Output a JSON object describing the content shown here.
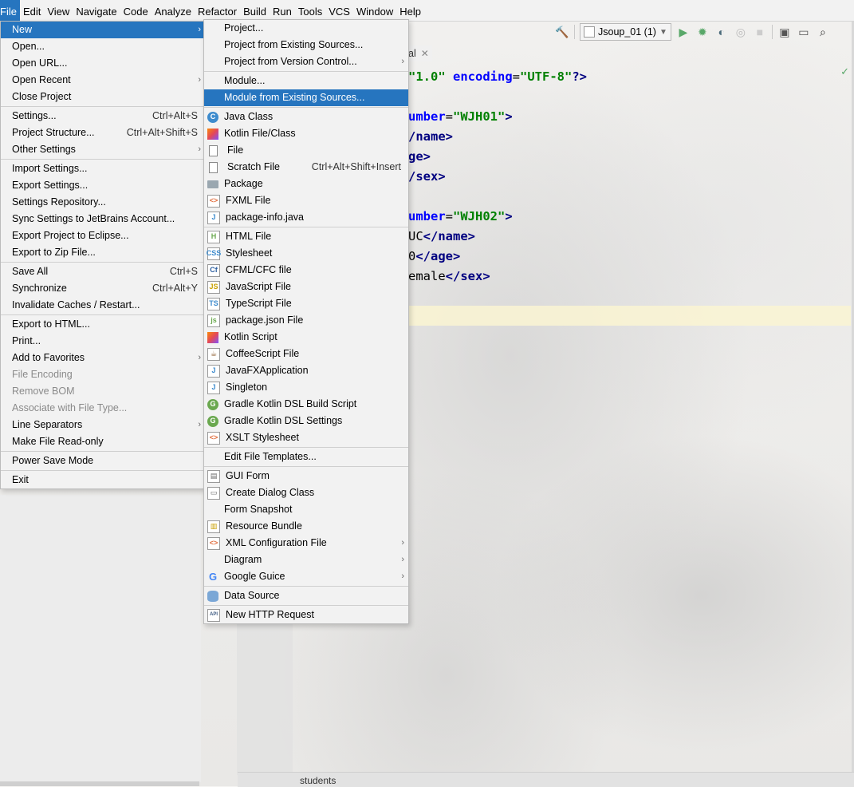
{
  "menubar": {
    "items": [
      "File",
      "Edit",
      "View",
      "Navigate",
      "Code",
      "Analyze",
      "Refactor",
      "Build",
      "Run",
      "Tools",
      "VCS",
      "Window",
      "Help"
    ]
  },
  "toolbar": {
    "run_config": "Jsoup_01 (1)",
    "icons": [
      "hammer-icon",
      "run-icon",
      "debug-icon",
      "coverage-icon",
      "profile-icon",
      "stop-icon",
      "project-structure-icon",
      "layout-icon",
      "search-icon"
    ],
    "colors": {
      "run": "#59a869",
      "hammer": "#59a869"
    }
  },
  "editor": {
    "tab_label": "al",
    "status_tab": "students",
    "code_lines": [
      "\"1.0\" encoding=\"UTF-8\"?>",
      "",
      "umber=\"WJH01\">",
      "/name>",
      "ge>",
      "/sex>",
      "",
      "umber=\"WJH02\">",
      "UC</name>",
      "0</age>",
      "emale</sex>"
    ]
  },
  "file_menu": {
    "items": [
      {
        "label": "New",
        "selected": true,
        "submenu": true
      },
      {
        "label": "Open..."
      },
      {
        "label": "Open URL..."
      },
      {
        "label": "Open Recent",
        "submenu": true
      },
      {
        "label": "Close Project"
      },
      {
        "sep": true
      },
      {
        "label": "Settings...",
        "shortcut": "Ctrl+Alt+S"
      },
      {
        "label": "Project Structure...",
        "shortcut": "Ctrl+Alt+Shift+S"
      },
      {
        "label": "Other Settings",
        "submenu": true
      },
      {
        "sep": true
      },
      {
        "label": "Import Settings..."
      },
      {
        "label": "Export Settings..."
      },
      {
        "label": "Settings Repository..."
      },
      {
        "label": "Sync Settings to JetBrains Account..."
      },
      {
        "label": "Export Project to Eclipse..."
      },
      {
        "label": "Export to Zip File..."
      },
      {
        "sep": true
      },
      {
        "label": "Save All",
        "shortcut": "Ctrl+S"
      },
      {
        "label": "Synchronize",
        "shortcut": "Ctrl+Alt+Y"
      },
      {
        "label": "Invalidate Caches / Restart..."
      },
      {
        "sep": true
      },
      {
        "label": "Export to HTML..."
      },
      {
        "label": "Print..."
      },
      {
        "label": "Add to Favorites",
        "submenu": true
      },
      {
        "label": "File Encoding",
        "disabled": true
      },
      {
        "label": "Remove BOM",
        "disabled": true
      },
      {
        "label": "Associate with File Type...",
        "disabled": true
      },
      {
        "label": "Line Separators",
        "submenu": true
      },
      {
        "label": "Make File Read-only"
      },
      {
        "sep": true
      },
      {
        "label": "Power Save Mode"
      },
      {
        "sep": true
      },
      {
        "label": "Exit"
      }
    ]
  },
  "new_menu": {
    "items": [
      {
        "label": "Project...",
        "icon": ""
      },
      {
        "label": "Project from Existing Sources...",
        "icon": ""
      },
      {
        "label": "Project from Version Control...",
        "icon": "",
        "submenu": true
      },
      {
        "sep": true
      },
      {
        "label": "Module...",
        "icon": ""
      },
      {
        "label": "Module from Existing Sources...",
        "icon": "",
        "selected": true
      },
      {
        "sep": true
      },
      {
        "label": "Java Class",
        "icon": "java-class-icon"
      },
      {
        "label": "Kotlin File/Class",
        "icon": "kotlin-file-icon"
      },
      {
        "label": "File",
        "icon": "file-icon"
      },
      {
        "label": "Scratch File",
        "icon": "scratch-file-icon",
        "shortcut": "Ctrl+Alt+Shift+Insert"
      },
      {
        "label": "Package",
        "icon": "package-icon"
      },
      {
        "label": "FXML File",
        "icon": "fxml-file-icon"
      },
      {
        "label": "package-info.java",
        "icon": "package-info-icon"
      },
      {
        "sep": true
      },
      {
        "label": "HTML File",
        "icon": "html-file-icon"
      },
      {
        "label": "Stylesheet",
        "icon": "stylesheet-icon"
      },
      {
        "label": "CFML/CFC file",
        "icon": "cfml-file-icon"
      },
      {
        "label": "JavaScript File",
        "icon": "javascript-file-icon"
      },
      {
        "label": "TypeScript File",
        "icon": "typescript-file-icon"
      },
      {
        "label": "package.json File",
        "icon": "package-json-icon"
      },
      {
        "label": "Kotlin Script",
        "icon": "kotlin-script-icon"
      },
      {
        "label": "CoffeeScript File",
        "icon": "coffeescript-file-icon"
      },
      {
        "label": "JavaFXApplication",
        "icon": "javafx-app-icon"
      },
      {
        "label": "Singleton",
        "icon": "singleton-icon"
      },
      {
        "label": "Gradle Kotlin DSL Build Script",
        "icon": "gradle-icon"
      },
      {
        "label": "Gradle Kotlin DSL Settings",
        "icon": "gradle-icon"
      },
      {
        "label": "XSLT Stylesheet",
        "icon": "xslt-icon"
      },
      {
        "sep": true
      },
      {
        "label": "Edit File Templates...",
        "icon": ""
      },
      {
        "sep": true
      },
      {
        "label": "GUI Form",
        "icon": "gui-form-icon"
      },
      {
        "label": "Create Dialog Class",
        "icon": "dialog-class-icon"
      },
      {
        "label": "Form Snapshot",
        "icon": ""
      },
      {
        "label": "Resource Bundle",
        "icon": "resource-bundle-icon"
      },
      {
        "label": "XML Configuration File",
        "icon": "xml-config-icon",
        "submenu": true
      },
      {
        "label": "Diagram",
        "icon": "",
        "submenu": true
      },
      {
        "label": "Google Guice",
        "icon": "google-icon",
        "submenu": true
      },
      {
        "sep": true
      },
      {
        "label": "Data Source",
        "icon": "data-source-icon"
      },
      {
        "sep": true
      },
      {
        "label": "New HTTP Request",
        "icon": "http-request-icon"
      }
    ]
  },
  "colors": {
    "selection": "#2675bf",
    "menu_bg": "#f2f2f2"
  }
}
